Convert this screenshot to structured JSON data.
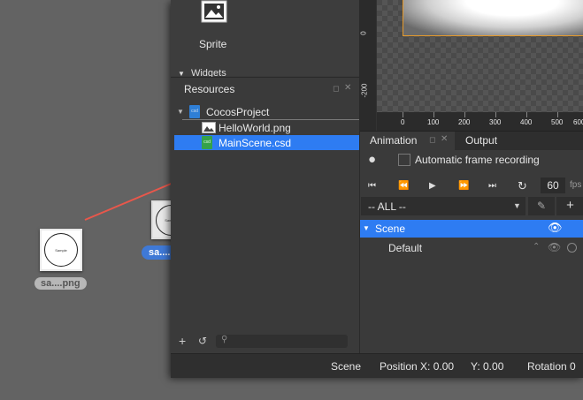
{
  "desktop": {
    "file_left_label": "sa....png",
    "file_dragged_label": "sa....png",
    "thumb_text": "Sample"
  },
  "widgets_panel": {
    "sprite_label": "Sprite",
    "section_label": "Widgets"
  },
  "resources": {
    "title": "Resources",
    "tree": {
      "project": "CocosProject",
      "items": [
        "HelloWorld.png",
        "MainScene.csd"
      ]
    }
  },
  "canvas": {
    "ruler_x": [
      "0",
      "100",
      "200",
      "300",
      "400",
      "500",
      "600"
    ],
    "ruler_y": [
      "0",
      "-200"
    ]
  },
  "animation": {
    "tab_animation": "Animation",
    "tab_output": "Output",
    "auto_frame_label": "Automatic frame recording",
    "fps_value": "60",
    "fps_unit": "fps",
    "filter_value": "-- ALL --",
    "scene_label": "Scene",
    "default_label": "Default"
  },
  "statusbar": {
    "object": "Scene",
    "position_x": "Position X: 0.00",
    "position_y": "Y: 0.00",
    "rotation": "Rotation 0"
  },
  "colors": {
    "selection": "#2e7cf2",
    "arrow": "#e8574b",
    "canvas_border": "#e79a2a"
  }
}
